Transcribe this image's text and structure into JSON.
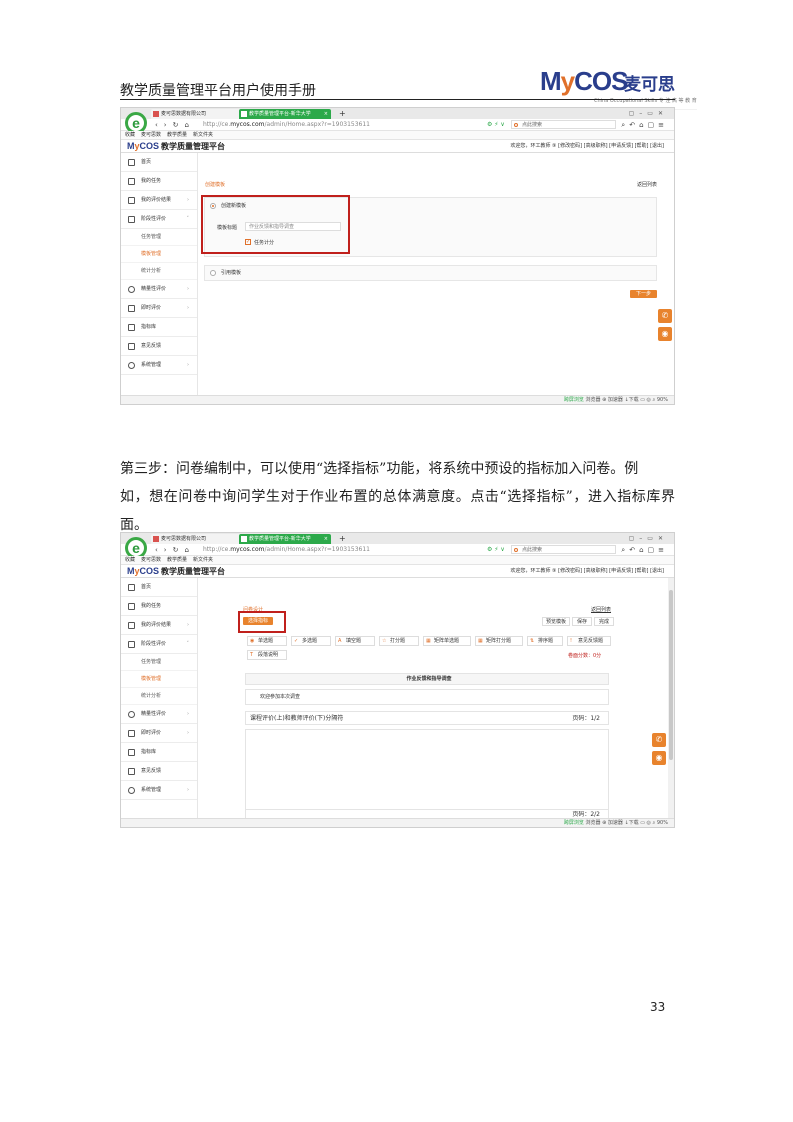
{
  "doc": {
    "title": "教学质量管理平台用户使用手册",
    "logo_text": "MyCOS",
    "logo_cn": "麦可思",
    "logo_sub": "China Occupational Skills  专 注 高 等 教 育",
    "page_number": "33",
    "paragraph_line1": "第三步：问卷编制中，可以使用“选择指标”功能，将系统中预设的指标加入问卷。例",
    "paragraph_line2": "如，想在问卷中询问学生对于作业布置的总体满意度。点击“选择指标”，进入指标库界面。"
  },
  "browser": {
    "tab1": "麦可思数据有限公司",
    "tab2": "教学质量管理平台-新华大学",
    "url_prefix": "http://ce.",
    "url_host": "mycos.com",
    "url_path": "/admin/Home.aspx?r=1903153611",
    "search_placeholder": "点此搜索",
    "bookmarks": [
      "收藏",
      "麦可思数",
      "教学质量",
      "新文件夹"
    ],
    "statusbar": "浏览器 ⊕  加速器  ↓下载  ▭  ◎  ⌕  90%",
    "statusbar_green": "跨屏浏览"
  },
  "app": {
    "logo": "MyCOS",
    "title": "教学质量管理平台",
    "userbar": "欢迎您，环工教师 ⑨   [修改密码]  [高级职称]  [申请反馈]  [帮助]  [退出]"
  },
  "sidebar": {
    "items": [
      "首页",
      "我的任务",
      "我的评价结果",
      "阶段性评价",
      "精量性评价",
      "即时评价",
      "指标库",
      "意见反馈",
      "系统管理"
    ],
    "subitems": [
      "任务管理",
      "模板管理",
      "统计分析"
    ]
  },
  "shot1": {
    "create_template_link": "创建模板",
    "return_link": "返回列表",
    "option_new": "创建新模板",
    "template_title_label": "模板标题",
    "template_title_value": "作业反馈和指导调查",
    "scoring_label": "任务计分",
    "option_cite": "引用模板",
    "next_button": "下一步"
  },
  "shot2": {
    "design_link": "问卷设计",
    "return_link": "返回列表",
    "select_indicator_button": "选择指标",
    "preview_button": "预览模板",
    "save_button": "保存",
    "finish_button": "完成",
    "question_types": [
      "单选题",
      "多选题",
      "填空题",
      "打分题",
      "矩阵单选题",
      "矩阵打分题",
      "排序题",
      "意见反馈题",
      "段落说明"
    ],
    "total_score": "卷面分数：0分",
    "survey_title": "作业反馈和指导调查",
    "welcome_row": "欢迎参加本次调查",
    "section_row": "课程评价(上)和教师评价(下)分隔符",
    "page1": "页码：1/2",
    "page2": "页码：2/2"
  },
  "colors": {
    "accent": "#e8832d",
    "brand": "#2a3e8c",
    "highlight": "#c0201c",
    "green": "#2ca94a"
  }
}
